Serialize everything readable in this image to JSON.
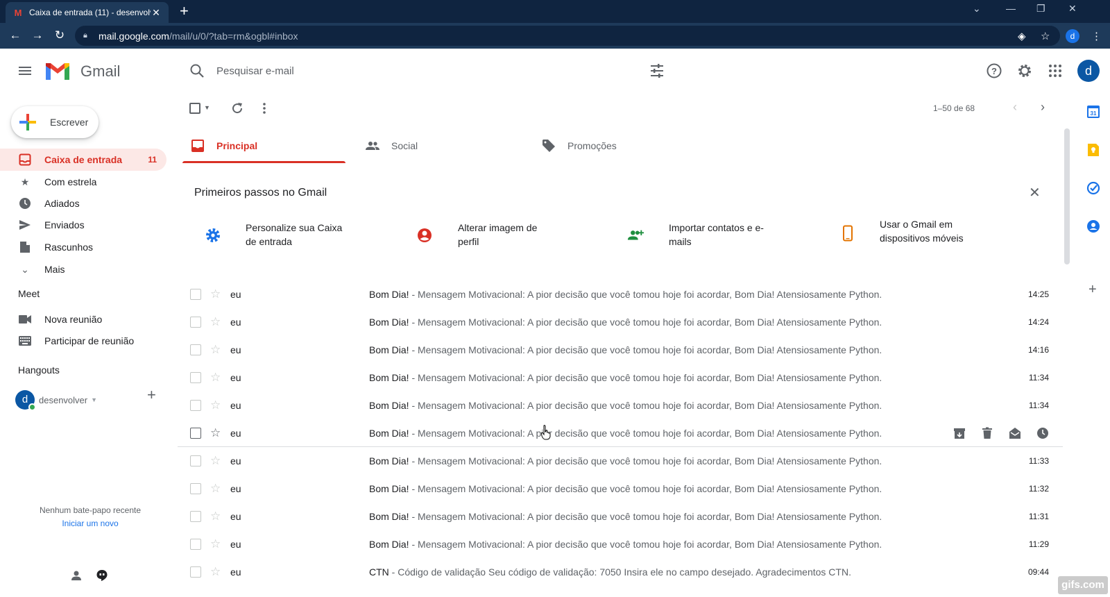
{
  "browser": {
    "tab_title": "Caixa de entrada (11) - desenvolv",
    "url_host": "mail.google.com",
    "url_path": "/mail/u/0/?tab=rm&ogbl#inbox",
    "profile_initial": "d"
  },
  "header": {
    "app_name": "Gmail",
    "search_placeholder": "Pesquisar e-mail",
    "avatar_initial": "d"
  },
  "sidebar": {
    "compose_label": "Escrever",
    "items": [
      {
        "label": "Caixa de entrada",
        "count": "11",
        "icon": "inbox-icon"
      },
      {
        "label": "Com estrela",
        "icon": "star-icon"
      },
      {
        "label": "Adiados",
        "icon": "clock-icon"
      },
      {
        "label": "Enviados",
        "icon": "send-icon"
      },
      {
        "label": "Rascunhos",
        "icon": "draft-icon"
      },
      {
        "label": "Mais",
        "icon": "chevron-down-icon"
      }
    ],
    "meet_title": "Meet",
    "meet_items": [
      {
        "label": "Nova reunião",
        "icon": "video-icon"
      },
      {
        "label": "Participar de reunião",
        "icon": "keyboard-icon"
      }
    ],
    "hangouts_title": "Hangouts",
    "hangouts_user": "desenvolver",
    "hangouts_user_initial": "d",
    "no_chat": "Nenhum bate-papo recente",
    "new_chat": "Iniciar um novo"
  },
  "toolbar": {
    "pager": "1–50 de 68"
  },
  "tabs": [
    {
      "label": "Principal",
      "icon": "inbox-icon"
    },
    {
      "label": "Social",
      "icon": "people-icon"
    },
    {
      "label": "Promoções",
      "icon": "tag-icon"
    }
  ],
  "getting_started": {
    "title": "Primeiros passos no Gmail",
    "items": [
      {
        "label": "Personalize sua Caixa de entrada",
        "icon": "gear-icon",
        "color": "#1a73e8"
      },
      {
        "label": "Alterar imagem de perfil",
        "icon": "account-icon",
        "color": "#d93025"
      },
      {
        "label": "Importar contatos e e-mails",
        "icon": "add-people-icon",
        "color": "#1e8e3e"
      },
      {
        "label": "Usar o Gmail em dispositivos móveis",
        "icon": "phone-icon",
        "color": "#e37400"
      }
    ]
  },
  "emails": [
    {
      "sender": "eu",
      "subject": "Bom Dia!",
      "snippet": " - Mensagem Motivacional: A pior decisão que você tomou hoje foi acordar, Bom Dia! Atensiosamente Python.",
      "time": "14:25"
    },
    {
      "sender": "eu",
      "subject": "Bom Dia!",
      "snippet": " - Mensagem Motivacional: A pior decisão que você tomou hoje foi acordar, Bom Dia! Atensiosamente Python.",
      "time": "14:24"
    },
    {
      "sender": "eu",
      "subject": "Bom Dia!",
      "snippet": " - Mensagem Motivacional: A pior decisão que você tomou hoje foi acordar, Bom Dia! Atensiosamente Python.",
      "time": "14:16"
    },
    {
      "sender": "eu",
      "subject": "Bom Dia!",
      "snippet": " - Mensagem Motivacional: A pior decisão que você tomou hoje foi acordar, Bom Dia! Atensiosamente Python.",
      "time": "11:34"
    },
    {
      "sender": "eu",
      "subject": "Bom Dia!",
      "snippet": " - Mensagem Motivacional: A pior decisão que você tomou hoje foi acordar, Bom Dia! Atensiosamente Python.",
      "time": "11:34"
    },
    {
      "sender": "eu",
      "subject": "Bom Dia!",
      "snippet": " - Mensagem Motivacional: A pior decisão que você tomou hoje foi acordar, Bom Dia! Atensiosamente Python.",
      "time": "",
      "hover": true
    },
    {
      "sender": "eu",
      "subject": "Bom Dia!",
      "snippet": " - Mensagem Motivacional: A pior decisão que você tomou hoje foi acordar, Bom Dia! Atensiosamente Python.",
      "time": "11:33"
    },
    {
      "sender": "eu",
      "subject": "Bom Dia!",
      "snippet": " - Mensagem Motivacional: A pior decisão que você tomou hoje foi acordar, Bom Dia! Atensiosamente Python.",
      "time": "11:32"
    },
    {
      "sender": "eu",
      "subject": "Bom Dia!",
      "snippet": " - Mensagem Motivacional: A pior decisão que você tomou hoje foi acordar, Bom Dia! Atensiosamente Python.",
      "time": "11:31"
    },
    {
      "sender": "eu",
      "subject": "Bom Dia!",
      "snippet": " - Mensagem Motivacional: A pior decisão que você tomou hoje foi acordar, Bom Dia! Atensiosamente Python.",
      "time": "11:29"
    },
    {
      "sender": "eu",
      "subject": "CTN",
      "snippet": " - Código de validação Seu código de validação: 7050 Insira ele no campo desejado. Agradecimentos CTN.",
      "time": "09:44"
    }
  ],
  "watermark": "gifs.com",
  "colors": {
    "accent_red": "#d93025",
    "chrome_dark": "#0f2440",
    "chrome_mid": "#1e3a5a",
    "link_blue": "#1a73e8"
  }
}
